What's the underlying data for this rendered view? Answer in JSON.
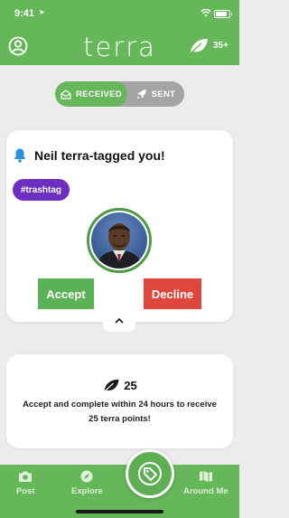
{
  "status_bar": {
    "time": "9:41"
  },
  "header": {
    "brand": "terra",
    "points": "35+"
  },
  "toggle": {
    "received_label": "RECEIVED",
    "sent_label": "SENT"
  },
  "notification": {
    "title": "Neil terra-tagged you!",
    "tag": "#trashtag",
    "accept_label": "Accept",
    "decline_label": "Decline"
  },
  "info": {
    "points": "25",
    "message": "Accept and complete within 24 hours to receive 25 terra points!"
  },
  "tabbar": {
    "post_label": "Post",
    "explore_label": "Explore",
    "around_label": "Around Me"
  },
  "colors": {
    "brand_green": "#66b75a",
    "accept_green": "#5bb156",
    "decline_red": "#e0473c",
    "tag_purple": "#6c2fc2"
  },
  "icons": [
    "location-arrow-icon",
    "wifi-icon",
    "battery-icon",
    "profile-icon",
    "leaf-icon",
    "envelope-icon",
    "rocket-icon",
    "bell-icon",
    "chevron-up-icon",
    "camera-icon",
    "compass-icon",
    "tag-icon",
    "map-icon"
  ]
}
